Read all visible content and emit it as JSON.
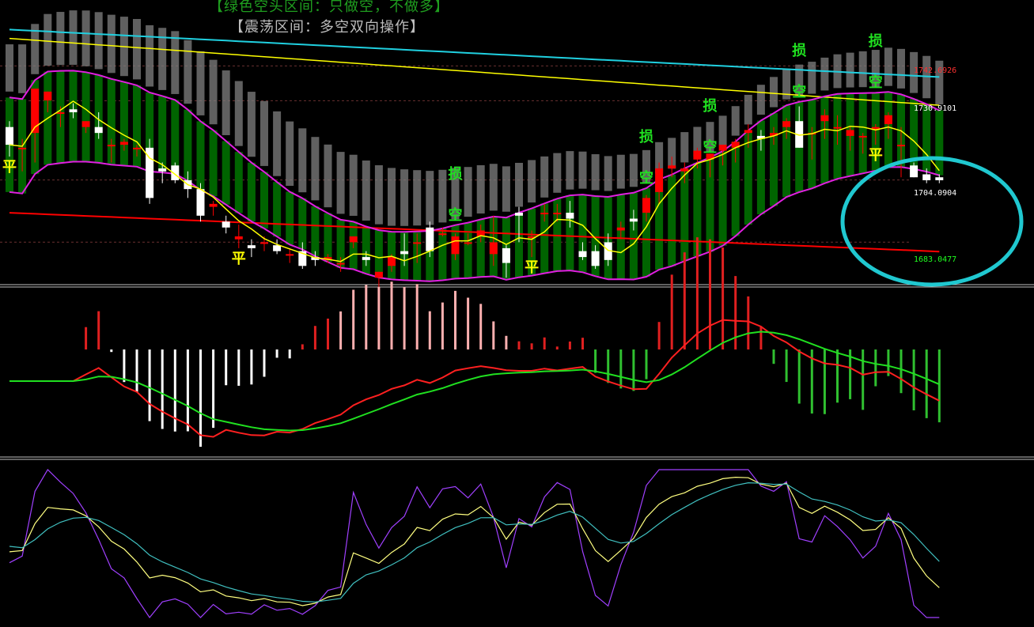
{
  "colors": {
    "background": "#000000",
    "bull": "#ff0000",
    "bear": "#ffffff",
    "green_band": "#006400",
    "gray_band": "#808080",
    "magenta": "#e020e0",
    "yellow": "#ffff00",
    "cyan": "#20d0e0",
    "red": "#ff0000",
    "macd_dif": "#ff2020",
    "macd_dea": "#20e020",
    "kdj_k": "#ffff80",
    "kdj_d": "#40c0c0",
    "kdj_j": "#a040ff",
    "highlight": "#20c8d0"
  },
  "header": {
    "line1": "【绿色空头区间：只做空，不做多】",
    "line2": "【震荡区间：多空双向操作】"
  },
  "price_labels": [
    {
      "text": "1742.6926",
      "value": 1742.6926,
      "color": "#ff3030"
    },
    {
      "text": "1730.9101",
      "value": 1730.9101,
      "color": "#ffffff"
    },
    {
      "text": "1704.0904",
      "value": 1704.0904,
      "color": "#ffffff"
    },
    {
      "text": "1683.0477",
      "value": 1683.0477,
      "color": "#20ff20"
    }
  ],
  "signals": [
    {
      "text": "平",
      "bar": 0,
      "pos": "below",
      "color": "#ffff00"
    },
    {
      "text": "平",
      "bar": 18,
      "pos": "below",
      "color": "#ffff00"
    },
    {
      "text": "平",
      "bar": 41,
      "pos": "below",
      "color": "#ffff00"
    },
    {
      "text": "平",
      "bar": 68,
      "pos": "below",
      "color": "#ffff00"
    },
    {
      "text": "损",
      "bar": 35,
      "pos": "top",
      "color": "#20e020"
    },
    {
      "text": "损",
      "bar": 50,
      "pos": "top",
      "color": "#20e020"
    },
    {
      "text": "损",
      "bar": 55,
      "pos": "top",
      "color": "#20e020"
    },
    {
      "text": "损",
      "bar": 62,
      "pos": "top",
      "color": "#20e020"
    },
    {
      "text": "损",
      "bar": 68,
      "pos": "top",
      "color": "#20e020"
    },
    {
      "text": "空",
      "bar": 35,
      "pos": "mid",
      "color": "#20e020"
    },
    {
      "text": "空",
      "bar": 50,
      "pos": "mid",
      "color": "#20e020"
    },
    {
      "text": "空",
      "bar": 55,
      "pos": "mid",
      "color": "#20e020"
    },
    {
      "text": "空",
      "bar": 62,
      "pos": "mid",
      "color": "#20e020"
    },
    {
      "text": "空",
      "bar": 68,
      "pos": "mid",
      "color": "#20e020"
    }
  ],
  "chart_data": [
    {
      "type": "candlestick",
      "panel": "price",
      "ylim": [
        1670,
        1765
      ],
      "candles": [
        [
          1722,
          1724,
          1712,
          1716
        ],
        [
          1715,
          1718,
          1707,
          1715
        ],
        [
          1720,
          1735,
          1710,
          1735
        ],
        [
          1731,
          1734,
          1727,
          1734
        ],
        [
          1727,
          1729,
          1722,
          1727
        ],
        [
          1728,
          1730,
          1725,
          1727
        ],
        [
          1722,
          1724,
          1720,
          1724
        ],
        [
          1722,
          1727,
          1718,
          1720
        ],
        [
          1716,
          1718,
          1710,
          1716
        ],
        [
          1716,
          1718,
          1714,
          1717
        ],
        [
          1715,
          1716,
          1712,
          1715
        ],
        [
          1715,
          1718,
          1696,
          1698
        ],
        [
          1708,
          1710,
          1703,
          1707
        ],
        [
          1709,
          1710,
          1703,
          1704
        ],
        [
          1704,
          1707,
          1698,
          1701
        ],
        [
          1701,
          1703,
          1690,
          1692
        ],
        [
          1695,
          1697,
          1692,
          1696
        ],
        [
          1690,
          1692,
          1686,
          1688
        ],
        [
          1684,
          1689,
          1681,
          1685
        ],
        [
          1682,
          1684,
          1678,
          1681
        ],
        [
          1683,
          1685,
          1680,
          1683
        ],
        [
          1682,
          1684,
          1679,
          1680
        ],
        [
          1679,
          1681,
          1676,
          1679
        ],
        [
          1680,
          1683,
          1674,
          1675
        ],
        [
          1678,
          1680,
          1675,
          1677
        ],
        [
          1677,
          1679,
          1676,
          1678
        ],
        [
          1676,
          1678,
          1673,
          1676
        ],
        [
          1683,
          1685,
          1681,
          1685
        ],
        [
          1678,
          1680,
          1675,
          1677
        ],
        [
          1671,
          1673,
          1668,
          1673
        ],
        [
          1675,
          1679,
          1673,
          1678
        ],
        [
          1680,
          1686,
          1675,
          1679
        ],
        [
          1683,
          1686,
          1676,
          1683
        ],
        [
          1688,
          1690,
          1678,
          1680
        ],
        [
          1686,
          1688,
          1685,
          1686
        ],
        [
          1679,
          1686,
          1677,
          1685
        ],
        [
          1683,
          1686,
          1682,
          1683
        ],
        [
          1685,
          1689,
          1683,
          1687
        ],
        [
          1679,
          1692,
          1675,
          1683
        ],
        [
          1681,
          1682,
          1671,
          1676
        ],
        [
          1693,
          1695,
          1683,
          1692
        ],
        [
          1685,
          1687,
          1678,
          1685
        ],
        [
          1693,
          1696,
          1690,
          1693
        ],
        [
          1693,
          1696,
          1690,
          1693
        ],
        [
          1693,
          1697,
          1688,
          1691
        ],
        [
          1680,
          1683,
          1677,
          1678
        ],
        [
          1680,
          1682,
          1674,
          1675
        ],
        [
          1683,
          1686,
          1675,
          1677
        ],
        [
          1687,
          1690,
          1684,
          1688
        ],
        [
          1691,
          1694,
          1687,
          1690
        ],
        [
          1693,
          1699,
          1690,
          1698
        ],
        [
          1700,
          1710,
          1696,
          1708
        ],
        [
          1708,
          1712,
          1705,
          1709
        ],
        [
          1707,
          1710,
          1703,
          1708
        ],
        [
          1711,
          1715,
          1708,
          1714
        ],
        [
          1711,
          1713,
          1705,
          1713
        ],
        [
          1714,
          1716,
          1709,
          1716
        ],
        [
          1715,
          1718,
          1710,
          1717
        ],
        [
          1720,
          1723,
          1715,
          1721
        ],
        [
          1719,
          1721,
          1714,
          1718
        ],
        [
          1719,
          1722,
          1716,
          1720
        ],
        [
          1722,
          1725,
          1718,
          1724
        ],
        [
          1724,
          1729,
          1715,
          1715
        ],
        [
          1720,
          1722,
          1711,
          1720
        ],
        [
          1724,
          1728,
          1718,
          1726
        ],
        [
          1722,
          1726,
          1716,
          1722
        ],
        [
          1719,
          1722,
          1714,
          1721
        ],
        [
          1719,
          1720,
          1713,
          1719
        ],
        [
          1721,
          1723,
          1716,
          1722
        ],
        [
          1723,
          1727,
          1718,
          1726
        ],
        [
          1716,
          1722,
          1705,
          1716
        ],
        [
          1709,
          1710,
          1705,
          1705
        ],
        [
          1706,
          1708,
          1703,
          1704
        ],
        [
          1705,
          1706,
          1703,
          1704
        ]
      ]
    },
    {
      "type": "bar",
      "panel": "macd",
      "ylim": [
        -10,
        10
      ]
    },
    {
      "type": "line",
      "panel": "kdj",
      "ylim": [
        0,
        100
      ]
    }
  ]
}
